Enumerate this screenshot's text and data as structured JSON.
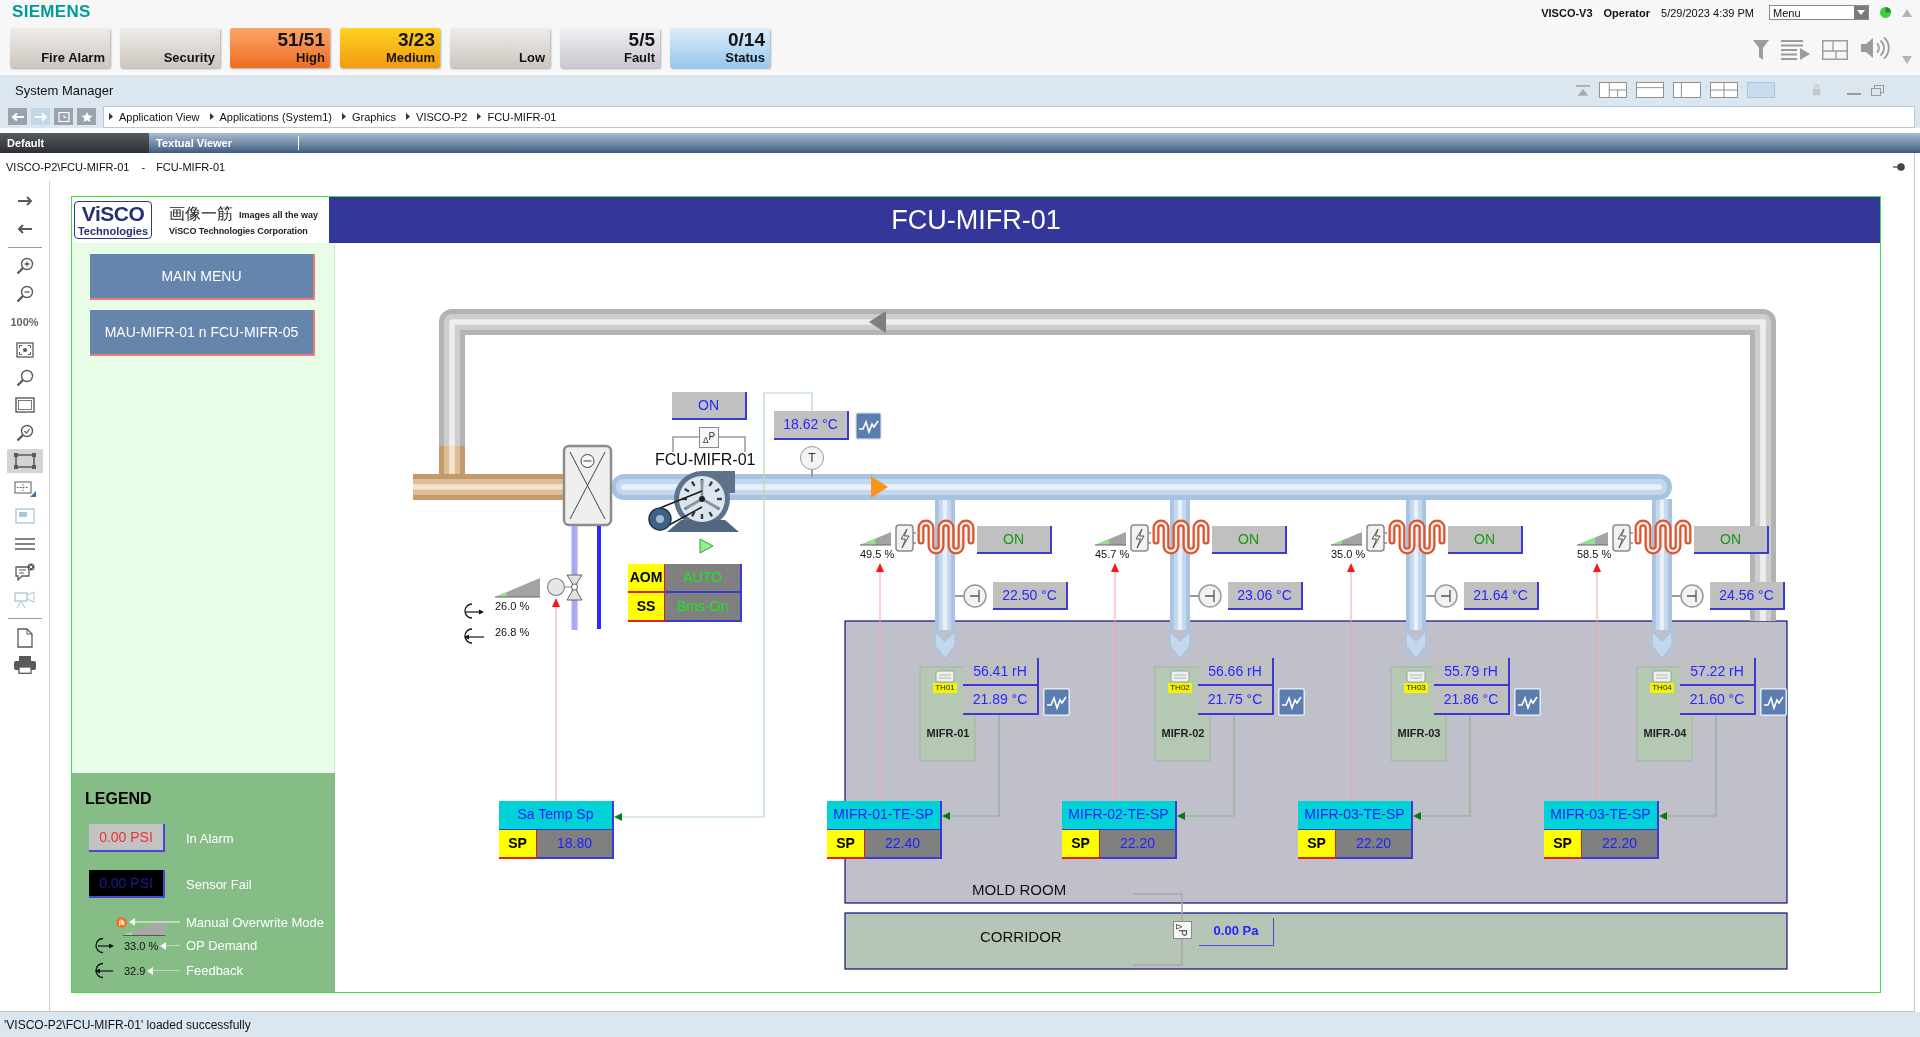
{
  "header": {
    "brand": "SIEMENS",
    "alarm_buttons": [
      {
        "label": "Fire Alarm",
        "kind": "neutral"
      },
      {
        "label": "Security",
        "kind": "neutral"
      },
      {
        "label": "High",
        "count": "51/51",
        "kind": "high"
      },
      {
        "label": "Medium",
        "count": "3/23",
        "kind": "medium"
      },
      {
        "label": "Low",
        "kind": "neutral"
      },
      {
        "label": "Fault",
        "count": "5/5",
        "kind": "fault"
      },
      {
        "label": "Status",
        "count": "0/14",
        "kind": "status"
      }
    ],
    "station": "VISCO-V3",
    "user": "Operator",
    "datetime": "5/29/2023 4:39 PM",
    "menu": {
      "value": "Menu"
    }
  },
  "system_manager": {
    "title": "System Manager",
    "layout_options": [
      {
        "kind": "three-pane",
        "selected": false
      },
      {
        "kind": "top-bottom",
        "selected": false
      },
      {
        "kind": "left-right",
        "selected": false
      },
      {
        "kind": "four-pane",
        "selected": false
      },
      {
        "kind": "single",
        "selected": true
      }
    ]
  },
  "navigation": {
    "buttons": [
      {
        "kind": "back",
        "disabled": false
      },
      {
        "kind": "forward",
        "disabled": true
      },
      {
        "kind": "history",
        "disabled": false
      },
      {
        "kind": "favorites",
        "disabled": false
      }
    ],
    "breadcrumb": [
      "Application View",
      "Applications (System1)",
      "Graphics",
      "VISCO-P2",
      "FCU-MIFR-01"
    ]
  },
  "tabs": [
    {
      "label": "Default",
      "selected": true
    },
    {
      "label": "Textual Viewer",
      "selected": false
    }
  ],
  "document": {
    "path": "VISCO-P2\\FCU-MIFR-01",
    "separator": "-",
    "name": "FCU-MIFR-01"
  },
  "tool_groups": [
    {
      "tools": [
        {
          "kind": "forward",
          "selected": false,
          "disabled": false
        },
        {
          "kind": "back",
          "selected": false,
          "disabled": false
        }
      ]
    },
    {
      "tools": [
        {
          "kind": "zoom-in",
          "selected": false,
          "disabled": false
        },
        {
          "kind": "zoom-out",
          "selected": false,
          "disabled": false
        },
        {
          "kind": "zoom-level",
          "label": "100%",
          "selected": false,
          "disabled": false
        },
        {
          "kind": "fit",
          "selected": false,
          "disabled": false
        },
        {
          "kind": "find",
          "selected": false,
          "disabled": false
        },
        {
          "kind": "frame",
          "selected": false,
          "disabled": false
        },
        {
          "kind": "zoom-check",
          "selected": false,
          "disabled": false
        },
        {
          "kind": "select-area",
          "selected": true,
          "disabled": false
        },
        {
          "kind": "grid",
          "selected": false,
          "disabled": false
        },
        {
          "kind": "snapshot",
          "selected": false,
          "disabled": true
        },
        {
          "kind": "lines",
          "selected": false,
          "disabled": false
        },
        {
          "kind": "comment",
          "selected": false,
          "disabled": false
        },
        {
          "kind": "camera",
          "selected": false,
          "disabled": true
        }
      ]
    },
    {
      "tools": [
        {
          "kind": "page",
          "selected": false,
          "disabled": false
        },
        {
          "kind": "print",
          "selected": false,
          "disabled": false
        }
      ]
    }
  ],
  "graphic": {
    "title": "FCU-MIFR-01",
    "logo": {
      "name": "ViSCO",
      "subtitle": "Technologies",
      "motto": "画像一筋",
      "tagline": "Images all the way",
      "company": "ViSCO Technologies Corporation"
    },
    "nav_buttons": [
      "MAIN MENU",
      "MAU-MIFR-01 n FCU-MIFR-05"
    ],
    "legend": {
      "title": "LEGEND",
      "items": [
        {
          "kind": "alarm",
          "sample": "0.00 PSI",
          "label": "In Alarm"
        },
        {
          "kind": "sensor-fail",
          "sample": "0.00 PSI",
          "label": "Sensor Fail"
        },
        {
          "kind": "manual",
          "label": "Manual Overwrite Mode"
        },
        {
          "kind": "demand",
          "sample": "33.0 %",
          "label": "OP Demand"
        },
        {
          "kind": "feedback",
          "sample": "32.9",
          "label": "Feedback"
        }
      ]
    },
    "fcu": {
      "name": "FCU-MIFR-01",
      "status": "ON",
      "dp_sensor": "$_{Δ}$P",
      "mode": {
        "label": "AOM",
        "value": "AUTO"
      },
      "start_stop": {
        "label": "SS",
        "value": "Bms-On"
      },
      "temp_sensor": "T",
      "supply_temp": "18.62 °C",
      "valve": {
        "level": 0.26,
        "demand": "26.0 %",
        "feedback": "26.8 %"
      },
      "setpoint": {
        "title": "Sa Temp Sp",
        "label": "SP",
        "value": "18.80"
      }
    },
    "zones": [
      {
        "heater": {
          "level": 0.495,
          "reading": "49.5 %"
        },
        "status": "ON",
        "duct_temp": "22.50 °C",
        "sensor": {
          "tag": "TH01",
          "name": "MIFR-01",
          "humidity": "56.41 rH",
          "temperature": "21.89 °C"
        },
        "setpoint": {
          "title": "MIFR-01-TE-SP",
          "label": "SP",
          "value": "22.40"
        }
      },
      {
        "heater": {
          "level": 0.457,
          "reading": "45.7 %"
        },
        "status": "ON",
        "duct_temp": "23.06 °C",
        "sensor": {
          "tag": "TH02",
          "name": "MIFR-02",
          "humidity": "56.66 rH",
          "temperature": "21.75 °C"
        },
        "setpoint": {
          "title": "MIFR-02-TE-SP",
          "label": "SP",
          "value": "22.20"
        }
      },
      {
        "heater": {
          "level": 0.35,
          "reading": "35.0 %"
        },
        "status": "ON",
        "duct_temp": "21.64 °C",
        "sensor": {
          "tag": "TH03",
          "name": "MIFR-03",
          "humidity": "55.79 rH",
          "temperature": "21.86 °C"
        },
        "setpoint": {
          "title": "MIFR-03-TE-SP",
          "label": "SP",
          "value": "22.20"
        }
      },
      {
        "heater": {
          "level": 0.585,
          "reading": "58.5 %"
        },
        "status": "ON",
        "duct_temp": "24.56 °C",
        "sensor": {
          "tag": "TH04",
          "name": "MIFR-04",
          "humidity": "57.22 rH",
          "temperature": "21.60 °C"
        },
        "setpoint": {
          "title": "MIFR-03-TE-SP",
          "label": "SP",
          "value": "22.20"
        }
      }
    ],
    "rooms": [
      {
        "name": "MOLD ROOM"
      },
      {
        "name": "CORRIDOR"
      }
    ],
    "room_pressure": {
      "sensor": "$_{Δ}$P",
      "value": "0.00 Pa"
    }
  },
  "status_bar": {
    "message": "'VISCO-P2\\FCU-MIFR-01' loaded successfully"
  }
}
